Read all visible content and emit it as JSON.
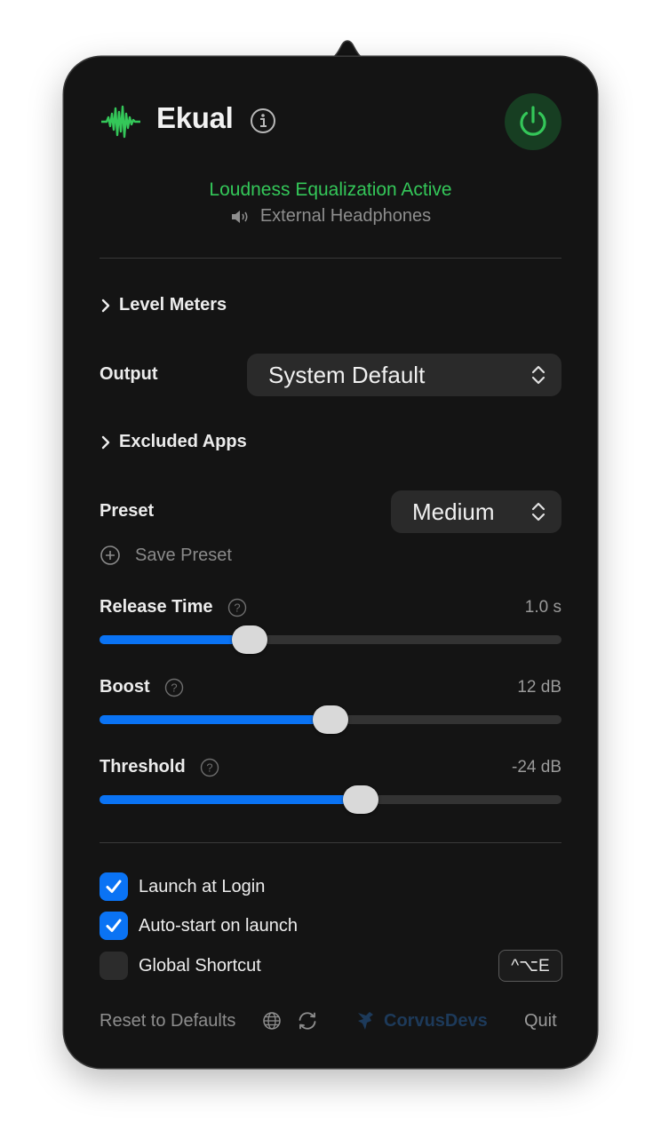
{
  "header": {
    "app_name": "Ekual",
    "accent_color": "#34c759"
  },
  "status": {
    "text": "Loudness Equalization Active",
    "device": "External Headphones"
  },
  "level_meters": {
    "label": "Level Meters"
  },
  "output": {
    "label": "Output",
    "selected": "System Default"
  },
  "excluded_apps": {
    "label": "Excluded Apps"
  },
  "preset": {
    "label": "Preset",
    "selected": "Medium",
    "save_label": "Save Preset"
  },
  "sliders": [
    {
      "label": "Release Time",
      "value": "1.0 s",
      "fraction": 0.325
    },
    {
      "label": "Boost",
      "value": "12 dB",
      "fraction": 0.5
    },
    {
      "label": "Threshold",
      "value": "-24 dB",
      "fraction": 0.565
    }
  ],
  "options": {
    "launch_at_login": {
      "label": "Launch at Login",
      "checked": true
    },
    "auto_start": {
      "label": "Auto-start on launch",
      "checked": true
    },
    "global_shortcut": {
      "label": "Global Shortcut",
      "checked": false,
      "keys": "^⌥E"
    }
  },
  "footer": {
    "reset_label": "Reset to Defaults",
    "brand": "CorvusDevs",
    "quit_label": "Quit"
  },
  "colors": {
    "slider_fill": "#0a73f4",
    "brand": "#1d3a5a"
  }
}
